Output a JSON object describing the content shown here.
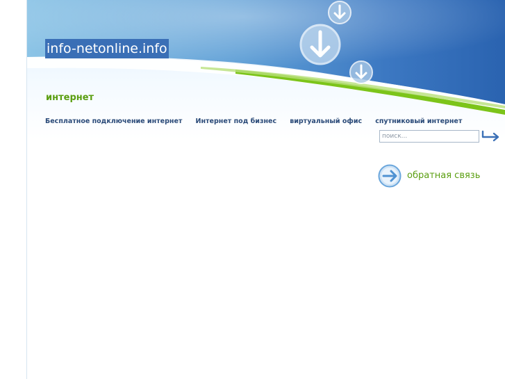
{
  "header": {
    "site_title": "info-netonline.info",
    "section_title": "интернет"
  },
  "nav": {
    "items": [
      {
        "label": "Бесплатное подключение интернет"
      },
      {
        "label": "Интернет под бизнес"
      },
      {
        "label": "виртуальный офис"
      },
      {
        "label": "спутниковый интернет"
      }
    ]
  },
  "search": {
    "placeholder": "поиск..."
  },
  "feedback": {
    "label": "обратная связь"
  },
  "colors": {
    "accent_green": "#5a9e10",
    "nav_blue": "#2a4a78",
    "header_blue": "#3a6fb6"
  },
  "icons": {
    "search_submit": "return-arrow-icon",
    "feedback": "arrow-right-circle-icon",
    "header_decor": "download-arrow-icon"
  }
}
